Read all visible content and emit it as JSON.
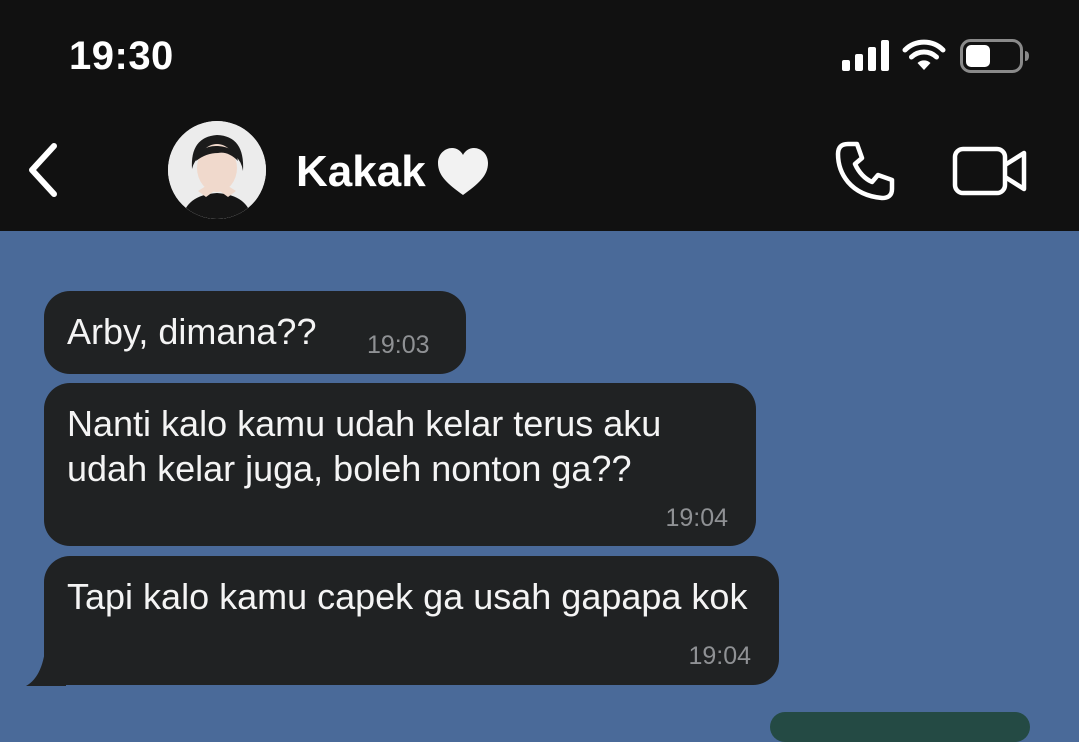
{
  "status_bar": {
    "time": "19:30",
    "icons": [
      "signal-icon",
      "wifi-icon",
      "battery-icon"
    ],
    "battery_level": 0.45
  },
  "header": {
    "contact_name": "Kakak",
    "icons": [
      "back-icon",
      "heart-icon",
      "phone-icon",
      "video-camera-icon"
    ]
  },
  "messages": [
    {
      "text": "Arby, dimana??",
      "time": "19:03",
      "direction": "incoming"
    },
    {
      "text": "Nanti kalo kamu udah kelar terus aku udah kelar juga, boleh nonton ga??",
      "time": "19:04",
      "direction": "incoming"
    },
    {
      "text": "Tapi kalo kamu capek ga usah gapapa kok",
      "time": "19:04",
      "direction": "incoming"
    }
  ],
  "colors": {
    "chat_background": "#4a6a99",
    "header_background": "#111111",
    "bubble_incoming": "#202223",
    "bubble_outgoing": "#244a44",
    "timestamp": "#8f9194"
  }
}
